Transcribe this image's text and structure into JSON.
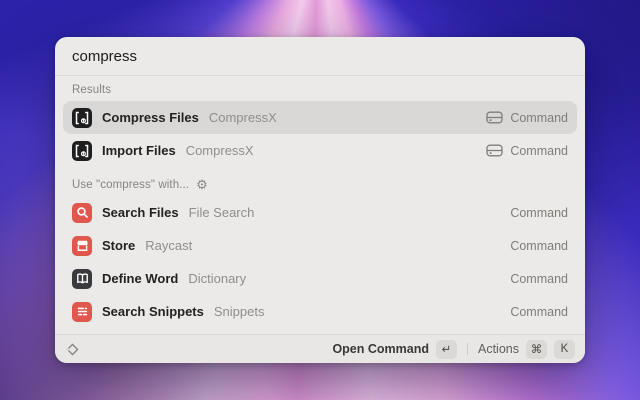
{
  "app": "Raycast",
  "colors": {
    "wallpaper_base": "#2c22a9",
    "wallpaper_ray_pink": "#f2c9ec",
    "window_bg": "#ebeae8",
    "selected_row_bg": "#dad8d6",
    "icon_red": "#e0574e",
    "icon_dark_gray": "#3a3a3c",
    "icon_black": "#1e1e1f"
  },
  "search": {
    "value": "compress",
    "placeholder": ""
  },
  "results": {
    "label": "Results",
    "rows": [
      {
        "title": "Compress Files",
        "subtitle": "CompressX",
        "type": "Command",
        "icon": "compressx-app-icon",
        "type_icon": "drive-icon",
        "selected": true
      },
      {
        "title": "Import Files",
        "subtitle": "CompressX",
        "type": "Command",
        "icon": "compressx-app-icon",
        "type_icon": "drive-icon",
        "selected": false
      }
    ]
  },
  "suggestions": {
    "label": "Use \"compress\" with...",
    "gear_icon": "⚙",
    "rows": [
      {
        "title": "Search Files",
        "subtitle": "File Search",
        "type": "Command",
        "icon": "file-search-icon"
      },
      {
        "title": "Store",
        "subtitle": "Raycast",
        "type": "Command",
        "icon": "store-icon"
      },
      {
        "title": "Define Word",
        "subtitle": "Dictionary",
        "type": "Command",
        "icon": "dictionary-icon"
      },
      {
        "title": "Search Snippets",
        "subtitle": "Snippets",
        "type": "Command",
        "icon": "snippets-icon"
      }
    ]
  },
  "footer": {
    "primary_action": "Open Command",
    "primary_key": "↵",
    "actions_label": "Actions",
    "actions_key_1": "⌘",
    "actions_key_2": "K"
  }
}
